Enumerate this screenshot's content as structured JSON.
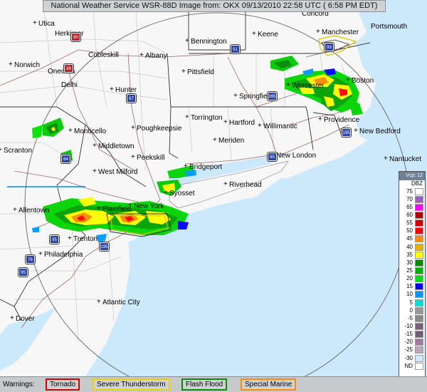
{
  "header": {
    "title": "National Weather Service WSR-88D Image from:  OKX 09/13/2010  22:58 UTC  ( 6:58 PM EDT)"
  },
  "cities": [
    {
      "name": "Concord"
    },
    {
      "name": "Utica"
    },
    {
      "name": "Herkimer"
    },
    {
      "name": "Bennington"
    },
    {
      "name": "Keene"
    },
    {
      "name": "Manchester"
    },
    {
      "name": "Portsmouth"
    },
    {
      "name": "Norwich"
    },
    {
      "name": "Cobleskill"
    },
    {
      "name": "Albany"
    },
    {
      "name": "Oneonta"
    },
    {
      "name": "Pittsfield"
    },
    {
      "name": "Delhi"
    },
    {
      "name": "Hunter"
    },
    {
      "name": "Worcester"
    },
    {
      "name": "Boston"
    },
    {
      "name": "Springfield"
    },
    {
      "name": "Torrington"
    },
    {
      "name": "Hartford"
    },
    {
      "name": "Willimantic"
    },
    {
      "name": "Providence"
    },
    {
      "name": "Monticello"
    },
    {
      "name": "Poughkeepsie"
    },
    {
      "name": "New Bedford"
    },
    {
      "name": "Meriden"
    },
    {
      "name": "Scranton"
    },
    {
      "name": "Middletown"
    },
    {
      "name": "New London"
    },
    {
      "name": "Nantucket"
    },
    {
      "name": "Peekskill"
    },
    {
      "name": "Bridgeport"
    },
    {
      "name": "West Milford"
    },
    {
      "name": "Riverhead"
    },
    {
      "name": "Syosset"
    },
    {
      "name": "Allentown"
    },
    {
      "name": "Plainfield"
    },
    {
      "name": "New York"
    },
    {
      "name": "Trenton"
    },
    {
      "name": "Philadelphia"
    },
    {
      "name": "Atlantic City"
    },
    {
      "name": "Dover"
    }
  ],
  "shields": [
    {
      "label": "88",
      "color": "red"
    },
    {
      "label": "90",
      "color": "red"
    },
    {
      "label": "91",
      "color": "blue"
    },
    {
      "label": "93",
      "color": "blue"
    },
    {
      "label": "87",
      "color": "red"
    },
    {
      "label": "84",
      "color": "blue"
    },
    {
      "label": "395",
      "color": "blue"
    },
    {
      "label": "195",
      "color": "blue"
    },
    {
      "label": "195",
      "color": "blue"
    },
    {
      "label": "95",
      "color": "blue"
    },
    {
      "label": "95",
      "color": "blue"
    },
    {
      "label": "76",
      "color": "blue"
    },
    {
      "label": "95",
      "color": "blue"
    }
  ],
  "legend": {
    "product": "Vcp: 12",
    "unit": "DBZ",
    "levels": [
      {
        "label": "75",
        "color": "#ffffff"
      },
      {
        "label": "70",
        "color": "#9c5ad0"
      },
      {
        "label": "65",
        "color": "#ff00ff"
      },
      {
        "label": "60",
        "color": "#b30000"
      },
      {
        "label": "55",
        "color": "#d40000"
      },
      {
        "label": "50",
        "color": "#ff0000"
      },
      {
        "label": "45",
        "color": "#ff8c00"
      },
      {
        "label": "40",
        "color": "#e6b000"
      },
      {
        "label": "35",
        "color": "#ffff00"
      },
      {
        "label": "30",
        "color": "#008a00"
      },
      {
        "label": "25",
        "color": "#00b400"
      },
      {
        "label": "20",
        "color": "#00e300"
      },
      {
        "label": "15",
        "color": "#0000ff"
      },
      {
        "label": "10",
        "color": "#0099ff"
      },
      {
        "label": "5",
        "color": "#00e0e0"
      },
      {
        "label": "0",
        "color": "#999999"
      },
      {
        "label": "-5",
        "color": "#8a8a8a"
      },
      {
        "label": "-10",
        "color": "#7b5f7b"
      },
      {
        "label": "-15",
        "color": "#6f5d77"
      },
      {
        "label": "-20",
        "color": "#a278a2"
      },
      {
        "label": "-25",
        "color": "#bda6bd"
      },
      {
        "label": "-30",
        "color": "#cfe8ff"
      },
      {
        "label": "ND",
        "color": "#ffffff"
      }
    ]
  },
  "warnings": {
    "label": "Warnings:",
    "items": [
      {
        "label": "Tornado",
        "color": "#d00000"
      },
      {
        "label": "Severe Thunderstorm",
        "color": "#e6d200"
      },
      {
        "label": "Flash Flood",
        "color": "#0a8a0a"
      },
      {
        "label": "Special Marine",
        "color": "#ff8c00"
      }
    ]
  }
}
